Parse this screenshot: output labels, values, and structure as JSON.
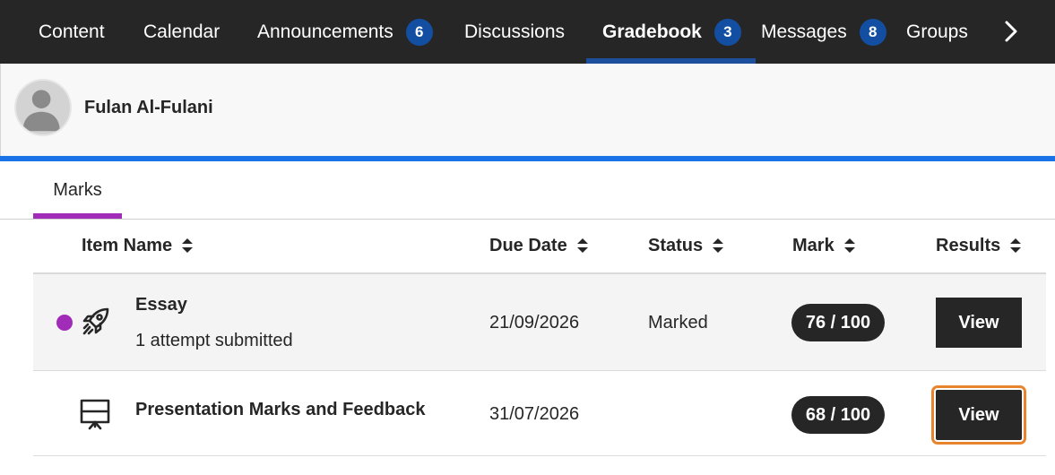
{
  "nav": {
    "items": [
      {
        "label": "Content"
      },
      {
        "label": "Calendar"
      },
      {
        "label": "Announcements",
        "badge": "6"
      },
      {
        "label": "Discussions"
      },
      {
        "label": "Gradebook",
        "badge": "3"
      },
      {
        "label": "Messages",
        "badge": "8"
      },
      {
        "label": "Groups"
      }
    ],
    "active": "Gradebook",
    "next_icon": "chevron-right-icon"
  },
  "user": {
    "name": "Fulan Al-Fulani",
    "avatar_icon": "user-silhouette-icon"
  },
  "tabs": [
    {
      "label": "Marks"
    }
  ],
  "table": {
    "headers": {
      "item_name": "Item Name",
      "due_date": "Due Date",
      "status": "Status",
      "mark": "Mark",
      "results": "Results"
    },
    "rows": [
      {
        "icon": "rocket-icon",
        "title": "Essay",
        "subtitle": "1 attempt submitted",
        "due_date": "21/09/2026",
        "status": "Marked",
        "mark": "76 / 100",
        "results_label": "View",
        "new_indicator": true
      },
      {
        "icon": "presentation-icon",
        "title": "Presentation Marks and Feedback",
        "subtitle": "",
        "due_date": "31/07/2026",
        "status": "",
        "mark": "68 / 100",
        "results_label": "View",
        "new_indicator": false
      }
    ]
  },
  "colors": {
    "nav_bg": "#262626",
    "nav_active_underline": "#1c4f9c",
    "badge_bg": "#124fa3",
    "accent_blue": "#1b73e8",
    "tab_underline": "#a02cb8",
    "focus_ring": "#e8842e"
  }
}
